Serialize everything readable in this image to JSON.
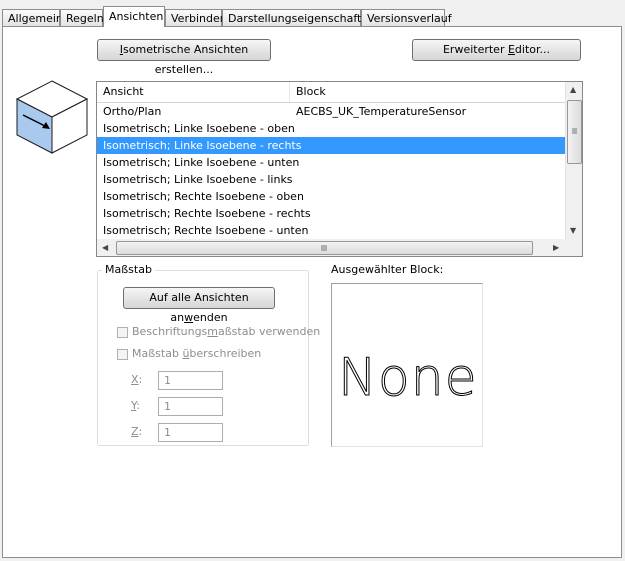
{
  "tabs": [
    {
      "label": "Allgemein",
      "active": false
    },
    {
      "label": "Regeln",
      "active": false
    },
    {
      "label": "Ansichten",
      "active": true
    },
    {
      "label": "Verbinder",
      "active": false
    },
    {
      "label": "Darstellungseigenschaften",
      "active": false
    },
    {
      "label": "Versionsverlauf",
      "active": false
    }
  ],
  "buttons": {
    "isometric_pre": "I",
    "isometric_post": "sometrische Ansichten erstellen...",
    "editor_pre": "Erweiterter ",
    "editor_ul": "E",
    "editor_post": "ditor...",
    "apply_pre": "Auf alle Ansichten an",
    "apply_ul": "w",
    "apply_post": "enden"
  },
  "view_list": {
    "columns": [
      "Ansicht",
      "Block"
    ],
    "rows": [
      {
        "view": "Ortho/Plan",
        "block": "AECBS_UK_TemperatureSensor",
        "selected": false
      },
      {
        "view": "Isometrisch; Linke Isoebene - oben",
        "block": "",
        "selected": false
      },
      {
        "view": "Isometrisch; Linke Isoebene - rechts",
        "block": "",
        "selected": true
      },
      {
        "view": "Isometrisch; Linke Isoebene - unten",
        "block": "",
        "selected": false
      },
      {
        "view": "Isometrisch; Linke Isoebene - links",
        "block": "",
        "selected": false
      },
      {
        "view": "Isometrisch; Rechte Isoebene - oben",
        "block": "",
        "selected": false
      },
      {
        "view": "Isometrisch; Rechte Isoebene - rechts",
        "block": "",
        "selected": false
      },
      {
        "view": "Isometrisch; Rechte Isoebene - unten",
        "block": "",
        "selected": false
      }
    ]
  },
  "scale": {
    "title": "Maßstab",
    "use_annotation_pre": "Beschriftungs",
    "use_annotation_ul": "m",
    "use_annotation_post": "aßstab verwenden",
    "use_annotation_checked": false,
    "override_pre": "Maßstab ",
    "override_ul": "ü",
    "override_post": "berschreiben",
    "override_checked": false,
    "x_label": "X",
    "y_label": "Y",
    "z_label": "Z",
    "colon": ":",
    "x_value": "1",
    "y_value": "1",
    "z_value": "1"
  },
  "selected_block": {
    "label": "Ausgewählter Block:",
    "preview_text": "None"
  },
  "colors": {
    "selection": "#3399ff",
    "cube_face": "#a9c9ef",
    "cube_stroke": "#1b1b1b"
  }
}
